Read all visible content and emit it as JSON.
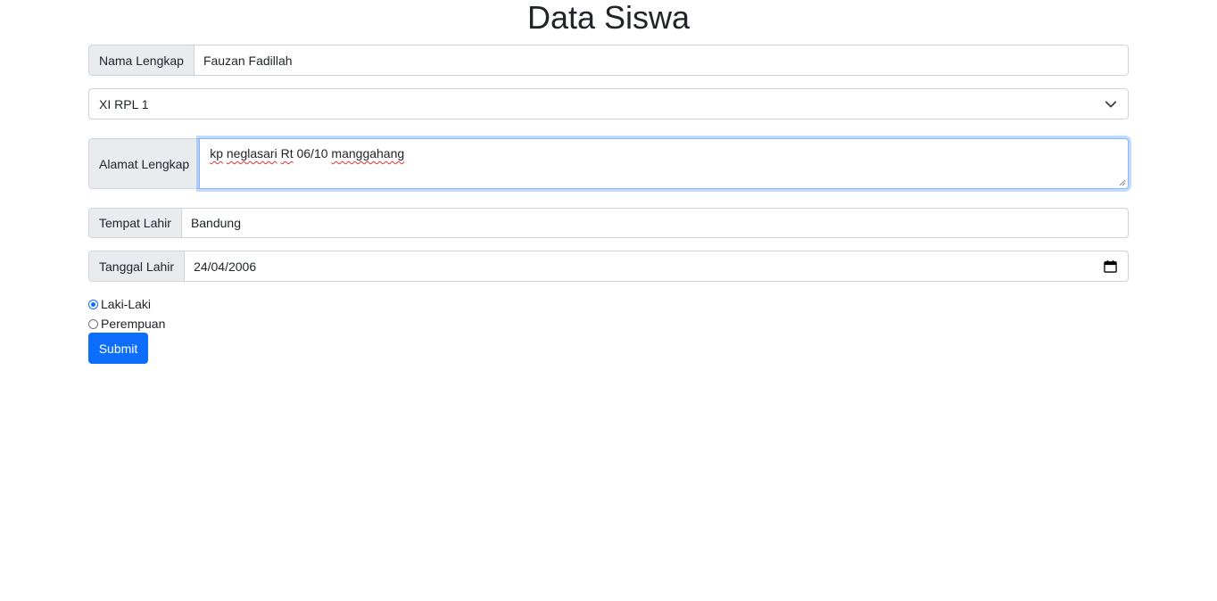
{
  "page": {
    "title": "Data Siswa"
  },
  "form": {
    "nama": {
      "label": "Nama Lengkap",
      "value": "Fauzan Fadillah"
    },
    "kelas": {
      "selected": "XI RPL 1"
    },
    "alamat": {
      "label": "Alamat Lengkap",
      "words": [
        "kp",
        "neglasari",
        "Rt",
        "06/10",
        "manggahang"
      ]
    },
    "tempat_lahir": {
      "label": "Tempat Lahir",
      "value": "Bandung"
    },
    "tanggal_lahir": {
      "label": "Tanggal Lahir",
      "value": "24/04/2006"
    },
    "gender": {
      "options": [
        {
          "label": "Laki-Laki",
          "checked": true
        },
        {
          "label": "Perempuan",
          "checked": false
        }
      ]
    },
    "submit_label": "Submit"
  },
  "colors": {
    "primary": "#0d6efd",
    "addon_bg": "#e9ecef",
    "border": "#ced4da",
    "spellcheck": "#dd3333"
  },
  "icons": {
    "select": "chevron-down-icon",
    "date": "calendar-icon"
  }
}
